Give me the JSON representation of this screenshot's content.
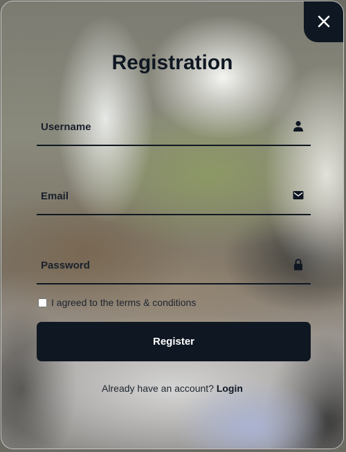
{
  "form": {
    "title": "Registration",
    "close_icon": "close-icon",
    "fields": {
      "username": {
        "placeholder": "Username",
        "icon": "user-icon"
      },
      "email": {
        "placeholder": "Email",
        "icon": "envelope-icon"
      },
      "password": {
        "placeholder": "Password",
        "icon": "lock-icon"
      }
    },
    "terms_label": "I agreed to the terms & conditions",
    "terms_checked": false,
    "register_label": "Register",
    "login_prompt": "Already have an account?",
    "login_link": "Login"
  },
  "colors": {
    "primary": "#0f1722",
    "button_text": "#ffffff"
  }
}
